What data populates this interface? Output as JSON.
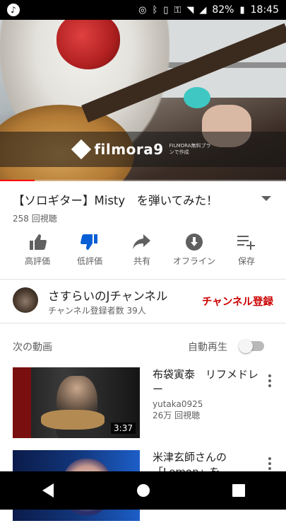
{
  "status_bar": {
    "battery": "82%",
    "time": "18:45"
  },
  "video": {
    "watermark_brand": "filmora9",
    "watermark_note": "FILMORA無料プランで作成",
    "progress": 0.12,
    "title": "【ソロギター】Misty　を弾いてみた！",
    "views": "258 回視聴"
  },
  "actions": [
    {
      "label": "高評価",
      "icon": "thumbs-up-icon"
    },
    {
      "label": "低評価",
      "icon": "thumbs-down-icon"
    },
    {
      "label": "共有",
      "icon": "share-icon"
    },
    {
      "label": "オフライン",
      "icon": "download-icon"
    },
    {
      "label": "保存",
      "icon": "add-to-playlist-icon"
    }
  ],
  "channel": {
    "name": "さすらいのJチャンネル",
    "subscribers": "チャンネル登録者数 39人",
    "subscribe_label": "チャンネル登録"
  },
  "up_next": {
    "label": "次の動画",
    "autoplay_label": "自動再生",
    "autoplay_on": false
  },
  "recommendations": [
    {
      "title": "布袋寅泰　リフメドレー",
      "channel": "yutaka0925",
      "views": "26万 回視聴",
      "duration": "3:37"
    },
    {
      "title": "米津玄師さんの「Lemon」を",
      "channel": "",
      "views": "",
      "duration": ""
    }
  ],
  "colors": {
    "accent_red": "#cc0000",
    "dislike_blue": "#065fd4",
    "progress_red": "#ff0000"
  }
}
